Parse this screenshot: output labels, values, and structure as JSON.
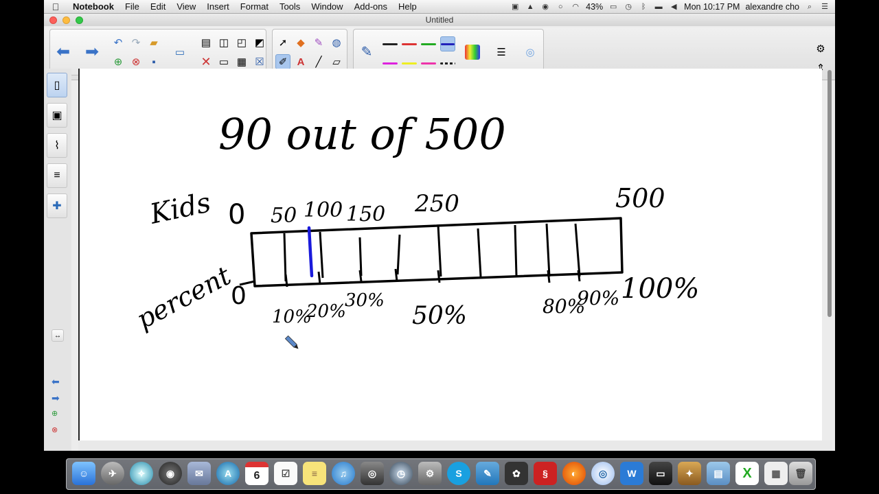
{
  "menubar": {
    "apple": "",
    "items": [
      "Notebook",
      "File",
      "Edit",
      "View",
      "Insert",
      "Format",
      "Tools",
      "Window",
      "Add-ons",
      "Help"
    ],
    "battery": "43%",
    "clock": "Mon 10:17 PM",
    "user": "alexandre cho"
  },
  "window": {
    "title": "Untitled"
  },
  "canvas": {
    "title_handwriting": "90 out of 500",
    "row_top_label": "Kids",
    "row_bottom_label": "percent",
    "top_start": "0",
    "bottom_start": "0",
    "top_ticks": [
      "50",
      "100",
      "150",
      "250",
      "500"
    ],
    "bottom_ticks": [
      "10%",
      "20%",
      "30%",
      "50%",
      "80%",
      "90%",
      "100%"
    ]
  },
  "dock": {
    "calendar_day": "6"
  },
  "colors": {
    "accent_blue": "#3a73c7",
    "ink": "#000000",
    "highlight_ink": "#1a1adb"
  }
}
